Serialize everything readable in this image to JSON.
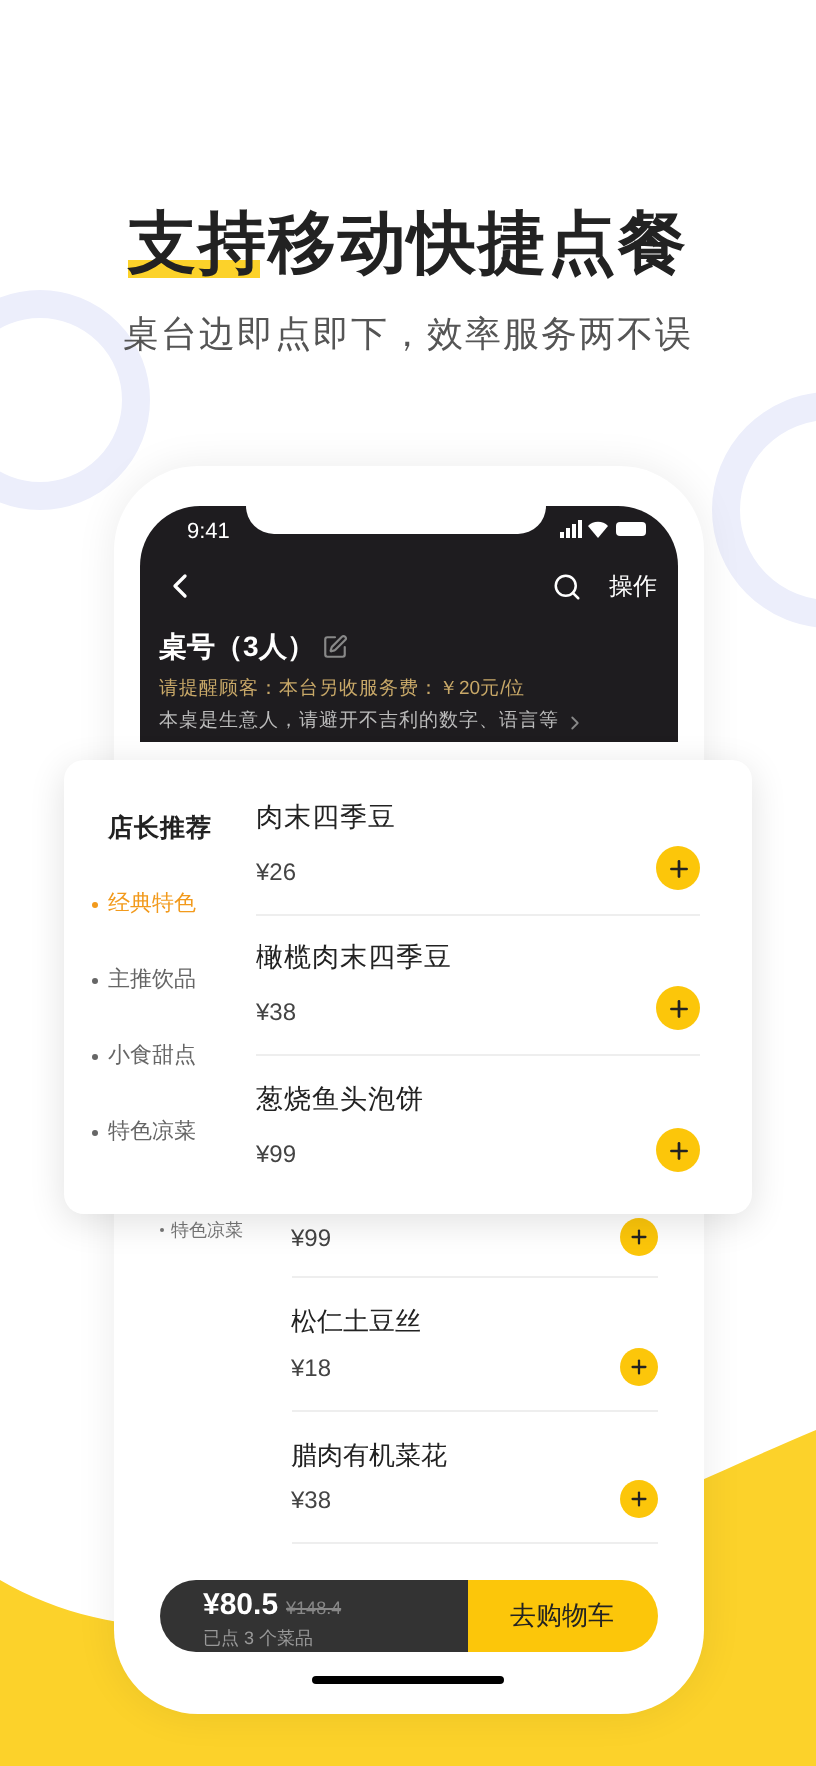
{
  "headline": "支持移动快捷点餐",
  "subtitle": "桌台边即点即下，效率服务两不误",
  "phone": {
    "status_time": "9:41",
    "header": {
      "action": "操作",
      "table": "桌号（3人）",
      "notice": "请提醒顾客：本台另收服务费：￥20元/位",
      "remark": "本桌是生意人，请避开不吉利的数字、语言等"
    },
    "list": {
      "category": "特色凉菜",
      "dishes": [
        {
          "price": "¥99"
        },
        {
          "name": "松仁土豆丝",
          "price": "¥18"
        },
        {
          "name": "腊肉有机菜花",
          "price": "¥38"
        }
      ]
    },
    "cart": {
      "total": "¥80.5",
      "original": "¥148.4",
      "count": "已点 3 个菜品",
      "button": "去购物车"
    }
  },
  "card": {
    "title": "店长推荐",
    "categories": [
      {
        "label": "经典特色",
        "selected": true
      },
      {
        "label": "主推饮品",
        "selected": false
      },
      {
        "label": "小食甜点",
        "selected": false
      },
      {
        "label": "特色凉菜",
        "selected": false
      }
    ],
    "dishes": [
      {
        "name": "肉末四季豆",
        "price": "¥26"
      },
      {
        "name": "橄榄肉末四季豆",
        "price": "¥38"
      },
      {
        "name": "葱烧鱼头泡饼",
        "price": "¥99"
      }
    ]
  }
}
